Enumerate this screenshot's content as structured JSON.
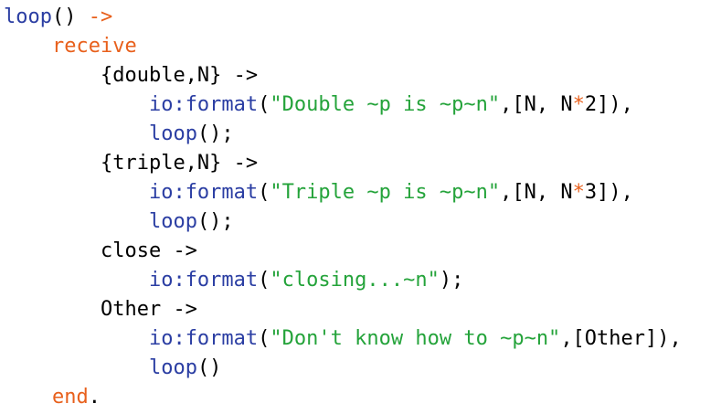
{
  "code": {
    "colors": {
      "function": "#2b3ea3",
      "keyword": "#e8601c",
      "string": "#24a33a",
      "operator": "#e8601c",
      "plain": "#000000",
      "background": "#ffffff"
    },
    "lines": [
      {
        "indent": "",
        "tokens": [
          {
            "t": "fn",
            "v": "loop"
          },
          {
            "t": "plain",
            "v": "() "
          },
          {
            "t": "kw",
            "v": "->"
          }
        ]
      },
      {
        "indent": "    ",
        "tokens": [
          {
            "t": "kw",
            "v": "receive"
          }
        ]
      },
      {
        "indent": "        ",
        "tokens": [
          {
            "t": "plain",
            "v": "{double,N} ->"
          }
        ]
      },
      {
        "indent": "            ",
        "tokens": [
          {
            "t": "fn",
            "v": "io:format"
          },
          {
            "t": "plain",
            "v": "("
          },
          {
            "t": "str",
            "v": "\"Double ~p is ~p~n\""
          },
          {
            "t": "plain",
            "v": ",[N, N"
          },
          {
            "t": "op",
            "v": "*"
          },
          {
            "t": "plain",
            "v": "2]),"
          }
        ]
      },
      {
        "indent": "            ",
        "tokens": [
          {
            "t": "fn",
            "v": "loop"
          },
          {
            "t": "plain",
            "v": "();"
          }
        ]
      },
      {
        "indent": "        ",
        "tokens": [
          {
            "t": "plain",
            "v": "{triple,N} ->"
          }
        ]
      },
      {
        "indent": "            ",
        "tokens": [
          {
            "t": "fn",
            "v": "io:format"
          },
          {
            "t": "plain",
            "v": "("
          },
          {
            "t": "str",
            "v": "\"Triple ~p is ~p~n\""
          },
          {
            "t": "plain",
            "v": ",[N, N"
          },
          {
            "t": "op",
            "v": "*"
          },
          {
            "t": "plain",
            "v": "3]),"
          }
        ]
      },
      {
        "indent": "            ",
        "tokens": [
          {
            "t": "fn",
            "v": "loop"
          },
          {
            "t": "plain",
            "v": "();"
          }
        ]
      },
      {
        "indent": "        ",
        "tokens": [
          {
            "t": "plain",
            "v": "close ->"
          }
        ]
      },
      {
        "indent": "            ",
        "tokens": [
          {
            "t": "fn",
            "v": "io:format"
          },
          {
            "t": "plain",
            "v": "("
          },
          {
            "t": "str",
            "v": "\"closing...~n\""
          },
          {
            "t": "plain",
            "v": ");"
          }
        ]
      },
      {
        "indent": "        ",
        "tokens": [
          {
            "t": "plain",
            "v": "Other ->"
          }
        ]
      },
      {
        "indent": "            ",
        "tokens": [
          {
            "t": "fn",
            "v": "io:format"
          },
          {
            "t": "plain",
            "v": "("
          },
          {
            "t": "str",
            "v": "\"Don't know how to ~p~n\""
          },
          {
            "t": "plain",
            "v": ",[Other]),"
          }
        ]
      },
      {
        "indent": "            ",
        "tokens": [
          {
            "t": "fn",
            "v": "loop"
          },
          {
            "t": "plain",
            "v": "()"
          }
        ]
      },
      {
        "indent": "    ",
        "tokens": [
          {
            "t": "kw",
            "v": "end"
          },
          {
            "t": "plain",
            "v": "."
          }
        ]
      }
    ]
  }
}
